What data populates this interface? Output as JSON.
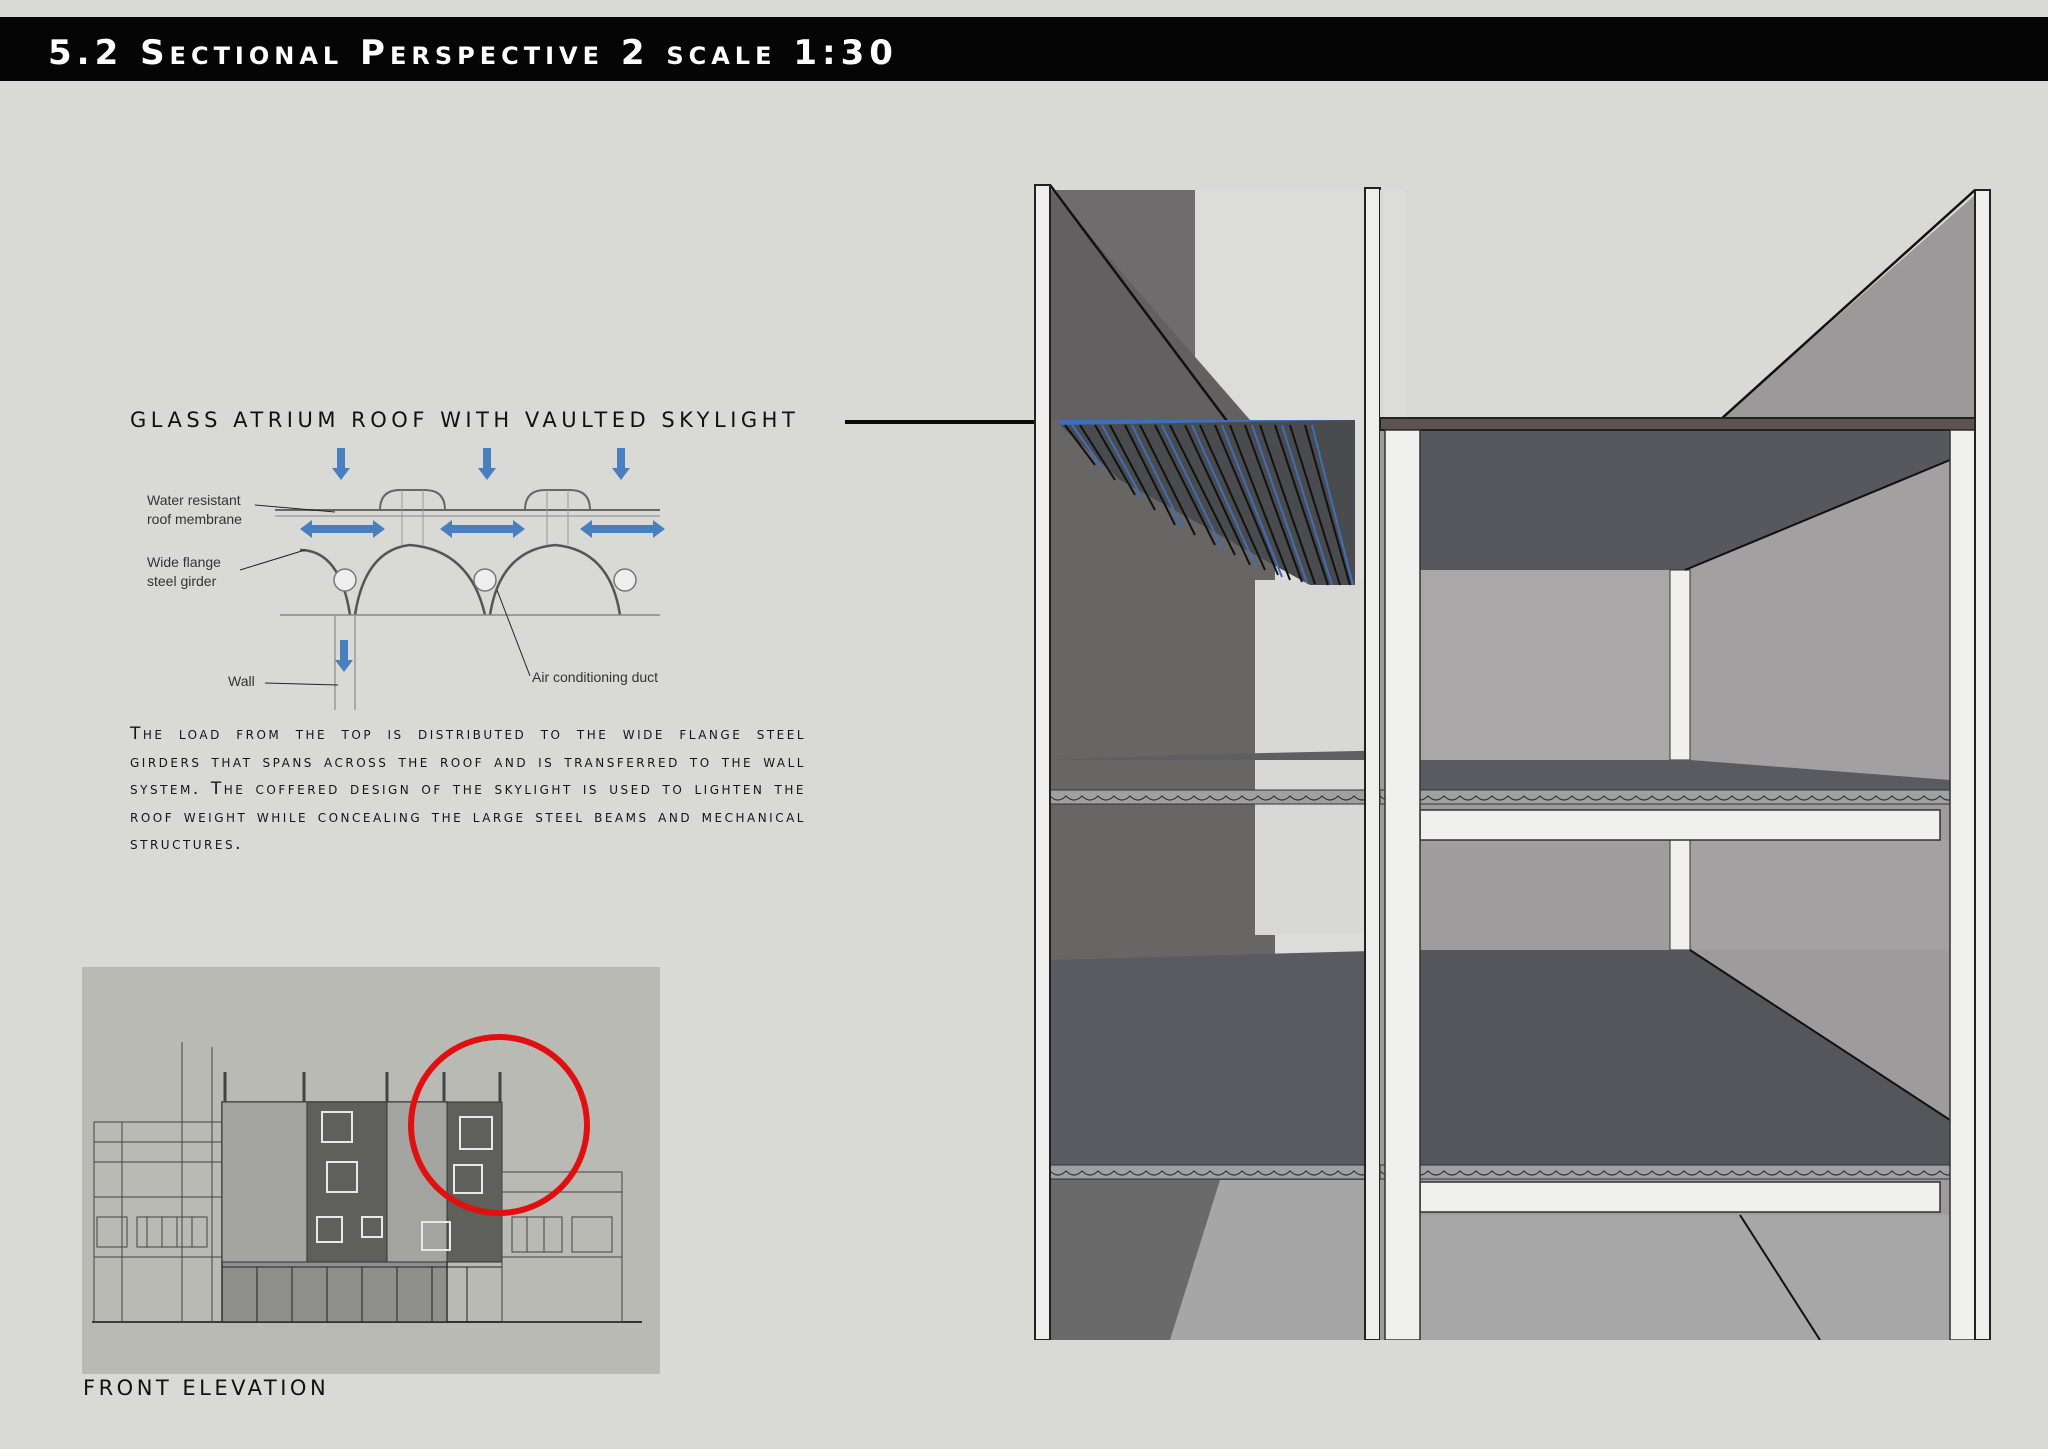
{
  "header": {
    "title": "5.2 Sectional Perspective 2 scale 1:30"
  },
  "callout": {
    "label": "GLASS ATRIUM ROOF WITH VAULTED SKYLIGHT"
  },
  "detail": {
    "labels": {
      "membrane": [
        "Water resistant",
        "roof membrane"
      ],
      "girder": [
        "Wide flange",
        "steel girder"
      ],
      "wall": "Wall",
      "duct": "Air conditioning duct"
    }
  },
  "description": {
    "text": "The load from the top is distributed to the wide flange steel girders that spans across the roof and is transferred to the wall system. The coffered design of the skylight is used to lighten the roof weight while concealing the large steel beams and mechanical structures."
  },
  "elevation": {
    "caption": "FRONT ELEVATION"
  },
  "colors": {
    "title_bar": "#050505",
    "background": "#d9dad6",
    "highlight_circle": "#e01010",
    "skylight_blue": "#3e6fb8",
    "arrow_blue": "#4a7fbf"
  }
}
